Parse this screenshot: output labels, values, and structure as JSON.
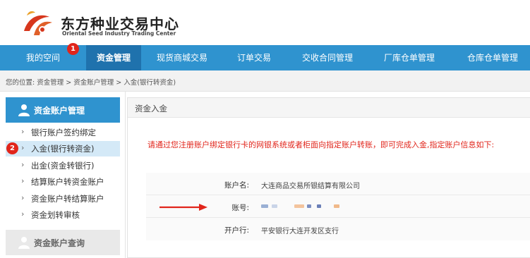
{
  "brand": {
    "name_cn": "东方种业交易中心",
    "name_en": "Oriental Seed Industry Trading Center"
  },
  "nav": {
    "items": [
      {
        "label": "我的空间"
      },
      {
        "label": "资金管理"
      },
      {
        "label": "现货商城交易"
      },
      {
        "label": "订单交易"
      },
      {
        "label": "交收合同管理"
      },
      {
        "label": "厂库仓单管理"
      },
      {
        "label": "仓库仓单管理"
      }
    ],
    "active": "资金管理"
  },
  "badges": [
    "1",
    "2"
  ],
  "breadcrumb": {
    "text": "您的位置:  资金管理 > 资金账户管理 > 入金(银行转资金)"
  },
  "sidebar": {
    "section_title": "资金账户管理",
    "items": [
      {
        "label": "银行账户签约绑定"
      },
      {
        "label": "入金(银行转资金)"
      },
      {
        "label": "出金(资金转银行)"
      },
      {
        "label": "结算账户转资金账户"
      },
      {
        "label": "资金账户转结算账户"
      },
      {
        "label": "资金划转审核"
      }
    ],
    "active_item": "入金(银行转资金)",
    "footer_title": "资金账户查询"
  },
  "panel": {
    "title": "资金入金",
    "notice": "请通过您注册账户绑定银行卡的网银系统或者柜面向指定账户转账，即可完成入金,指定账户信息如下:",
    "fields": [
      {
        "key": "账户名:",
        "value": "大连商品交易所银结算有限公司"
      },
      {
        "key": "账号:",
        "value": ""
      },
      {
        "key": "开户行:",
        "value": "平安银行大连开发区支行"
      }
    ]
  },
  "colors": {
    "nav_bg": "#2f93cf",
    "nav_active": "#1f72ad",
    "badge": "#e1251b",
    "notice": "#e1251b",
    "sidebar_active": "#d4e9f7"
  },
  "icons": {
    "logo": "seed-logo-icon",
    "sidebar_head": "user-icon",
    "chevron": "chevron-right-icon",
    "annotation": "red-arrow-icon"
  }
}
